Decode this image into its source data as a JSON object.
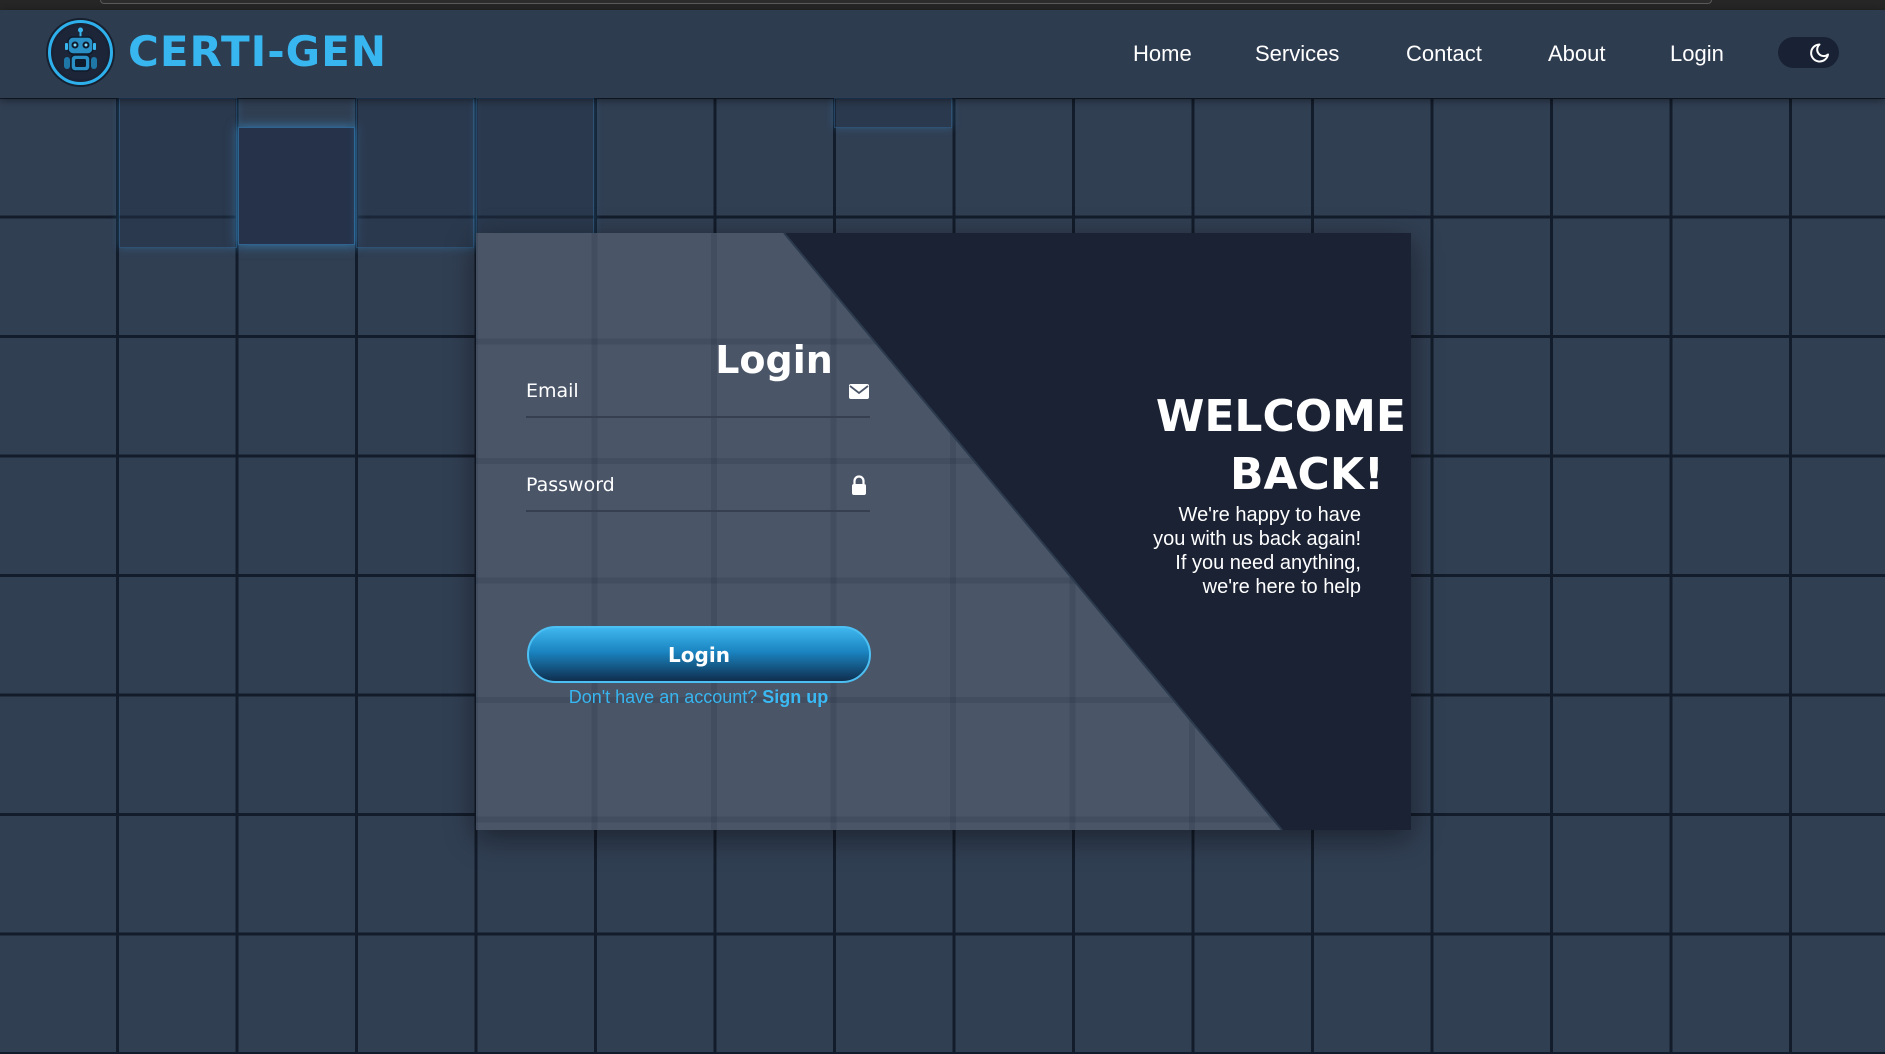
{
  "navbar": {
    "brand": "CERTI-GEN",
    "links": [
      {
        "label": "Home"
      },
      {
        "label": "Services"
      },
      {
        "label": "Contact"
      },
      {
        "label": "About"
      },
      {
        "label": "Login"
      }
    ],
    "theme_toggle_icon": "moon-icon"
  },
  "login_form": {
    "title": "Login",
    "email": {
      "placeholder": "Email",
      "value": "",
      "icon": "envelope-icon"
    },
    "password": {
      "placeholder": "Password",
      "value": "",
      "icon": "lock-icon"
    },
    "submit_label": "Login",
    "signup_prompt": "Don't have an account?",
    "signup_link": "Sign up"
  },
  "welcome_panel": {
    "title_line1": "WELCOME",
    "title_line2": "BACK!",
    "subtitle_lines": [
      "We're happy to have",
      "you with us back again!",
      "If you need anything,",
      "we're here to help"
    ]
  },
  "colors": {
    "accent": "#38b6f0",
    "page_bg": "#313f53",
    "grid_line": "#131c2a",
    "nav_bg": "#2e3c50",
    "card_left": "#4a5568",
    "card_right": "#1a2234"
  }
}
